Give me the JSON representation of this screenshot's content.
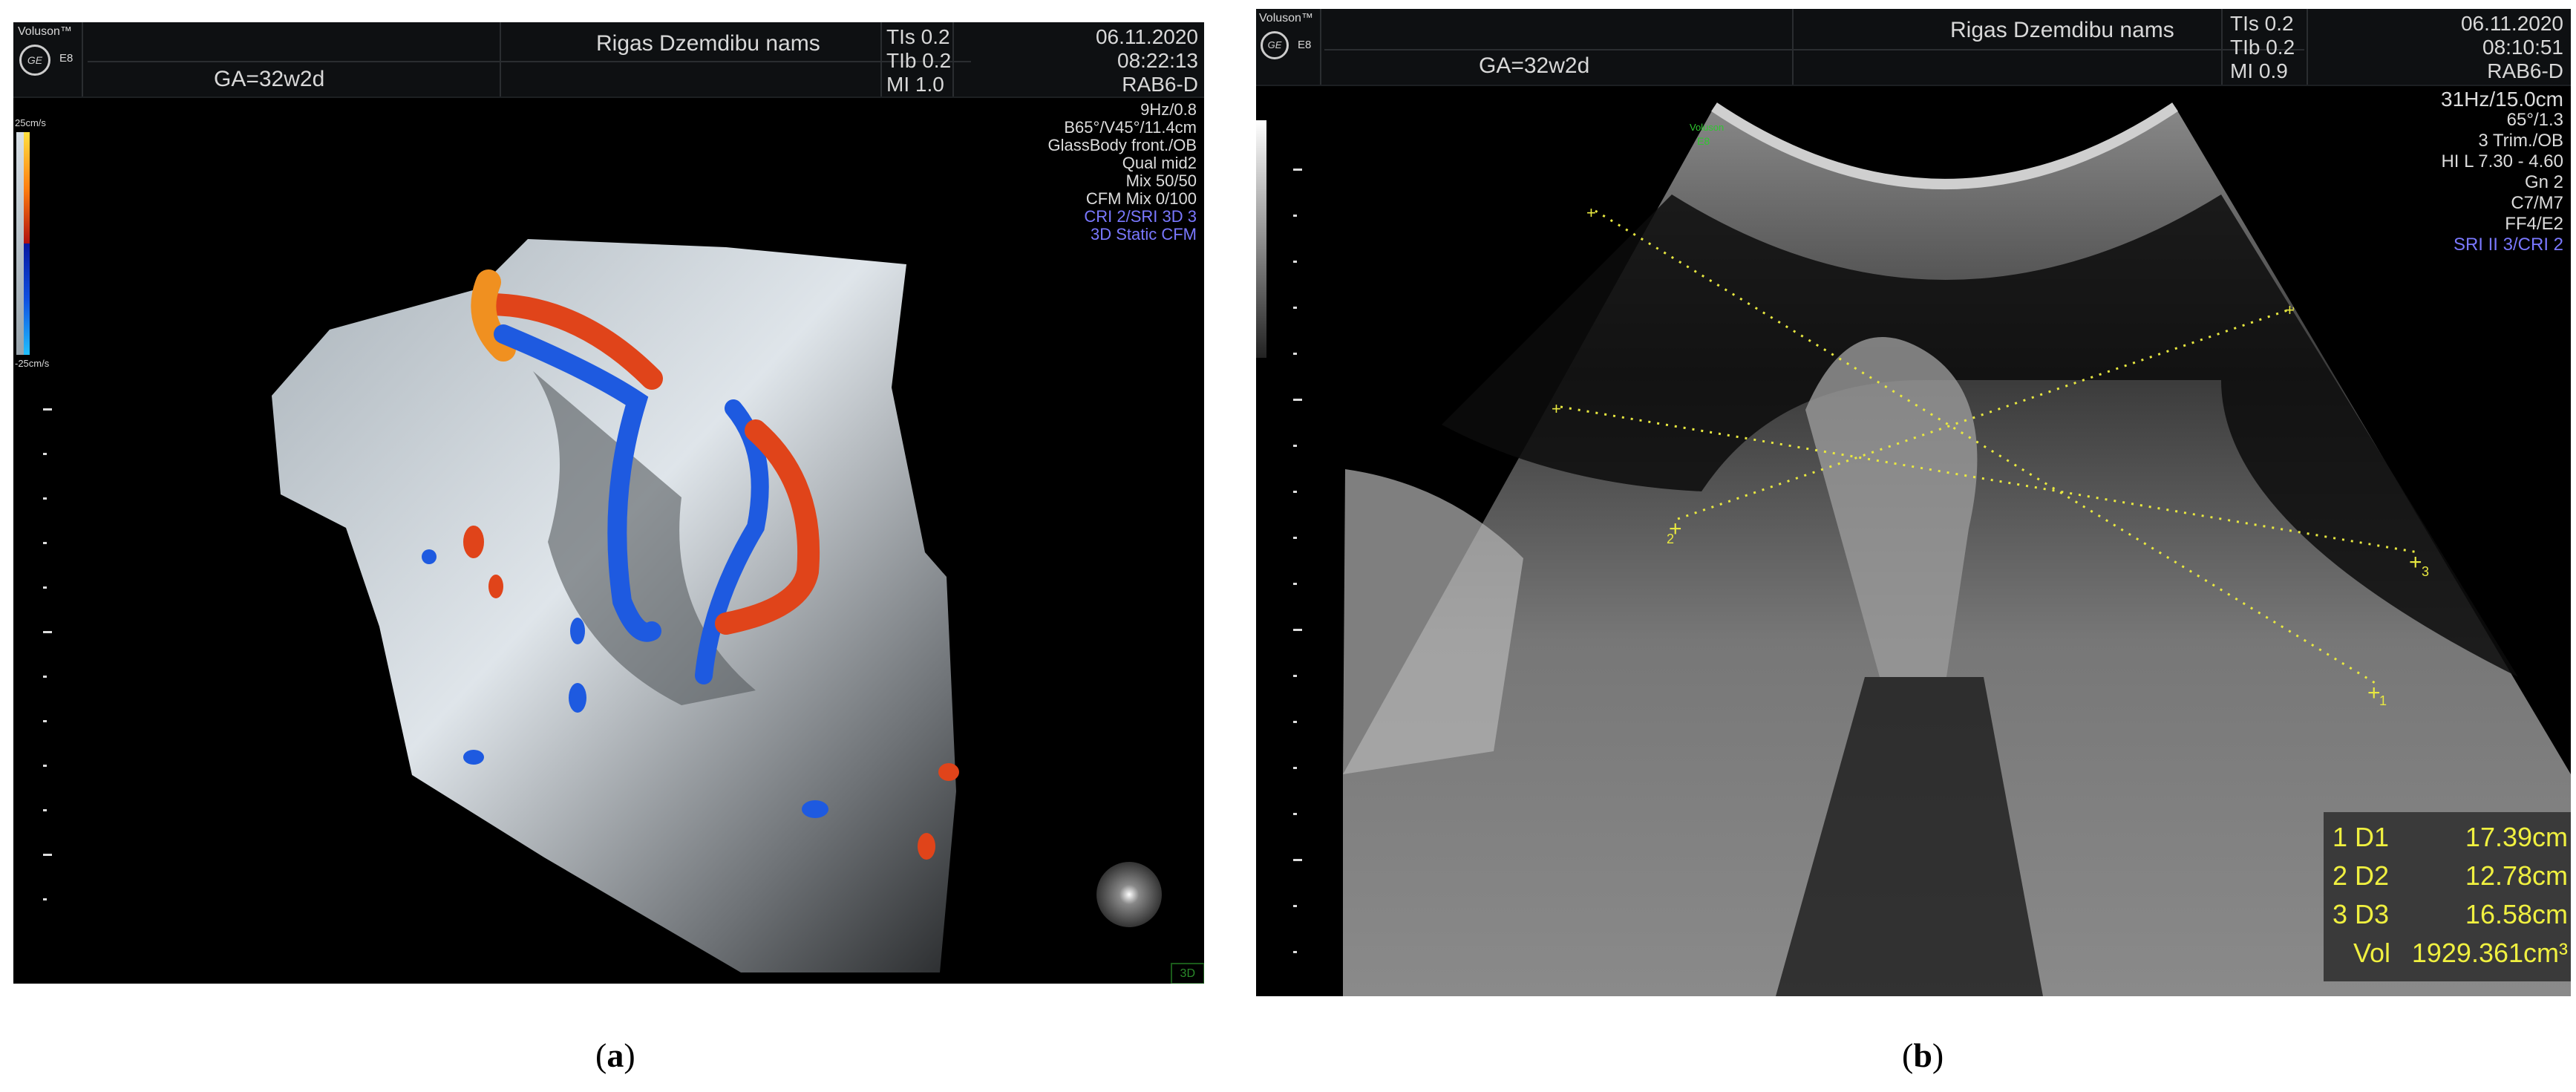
{
  "panel_a": {
    "brand": "Voluson™",
    "model": "E8",
    "logo_text": "GE",
    "facility": "Rigas Dzemdibu nams",
    "ga": "GA=32w2d",
    "tis": "TIs 0.2",
    "tib": "TIb 0.2",
    "mi": "MI 1.0",
    "date": "06.11.2020",
    "time": "08:22:13",
    "probe": "RAB6-D",
    "scale_top": "25cm/s",
    "scale_bottom": "-25cm/s",
    "params": [
      "9Hz/0.8",
      "B65°/V45°/11.4cm",
      "GlassBody front./OB",
      "Qual mid2",
      "Mix 50/50",
      "CFM Mix 0/100"
    ],
    "params_blue": [
      "CRI 2/SRI 3D 3",
      "3D Static CFM"
    ],
    "mode_label": "3D",
    "caption": "a"
  },
  "panel_b": {
    "brand": "Voluson™",
    "model": "E8",
    "logo_text": "GE",
    "watermark": [
      "Voluson",
      "E8"
    ],
    "facility": "Rigas Dzemdibu nams",
    "ga": "GA=32w2d",
    "tis": "TIs 0.2",
    "tib": "TIb 0.2",
    "mi": "MI 0.9",
    "date": "06.11.2020",
    "time": "08:10:51",
    "probe": "RAB6-D",
    "params": [
      "31Hz/15.0cm",
      "65°/1.3",
      "3 Trim./OB",
      "HI L  7.30 - 4.60",
      "Gn  2",
      "C7/M7",
      "FF4/E2"
    ],
    "params_blue": [
      "SRI II 3/CRI 2"
    ],
    "markers": [
      "1",
      "2",
      "3"
    ],
    "measurements": [
      {
        "label": "1 D1",
        "value": "17.39cm"
      },
      {
        "label": "2 D2",
        "value": "12.78cm"
      },
      {
        "label": "3 D3",
        "value": "16.58cm"
      }
    ],
    "volume": {
      "label": "Vol",
      "value": "1929.361cm³"
    },
    "caption": "b"
  },
  "colors": {
    "measure": "#f0f040",
    "blue_text": "#7a78ff",
    "flow_red": "#e0441a",
    "flow_blue": "#1e5ae0"
  }
}
